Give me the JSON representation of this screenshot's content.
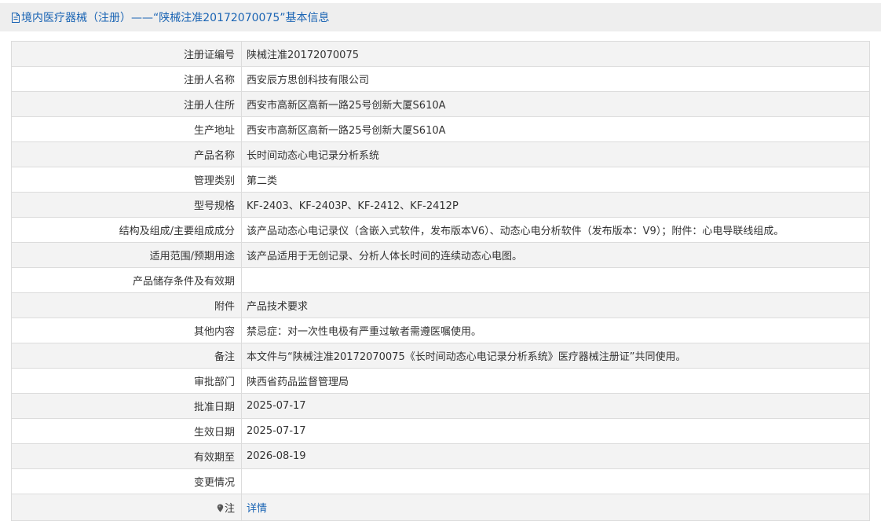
{
  "header": {
    "title": "境内医疗器械（注册）——“陕械注准20172070075”基本信息",
    "icon": "document-icon"
  },
  "rows": [
    {
      "label": "注册证编号",
      "value": "陕械注准20172070075"
    },
    {
      "label": "注册人名称",
      "value": "西安辰方思创科技有限公司"
    },
    {
      "label": "注册人住所",
      "value": "西安市高新区高新一路25号创新大厦S610A"
    },
    {
      "label": "生产地址",
      "value": "西安市高新区高新一路25号创新大厦S610A"
    },
    {
      "label": "产品名称",
      "value": "长时间动态心电记录分析系统"
    },
    {
      "label": "管理类别",
      "value": "第二类"
    },
    {
      "label": "型号规格",
      "value": "KF-2403、KF-2403P、KF-2412、KF-2412P"
    },
    {
      "label": "结构及组成/主要组成成分",
      "value": "该产品动态心电记录仪（含嵌入式软件，发布版本V6）、动态心电分析软件（发布版本：V9）；附件：心电导联线组成。"
    },
    {
      "label": "适用范围/预期用途",
      "value": "该产品适用于无创记录、分析人体长时间的连续动态心电图。"
    },
    {
      "label": "产品储存条件及有效期",
      "value": ""
    },
    {
      "label": "附件",
      "value": "产品技术要求"
    },
    {
      "label": "其他内容",
      "value": "禁忌症：对一次性电极有严重过敏者需遵医嘱使用。"
    },
    {
      "label": "备注",
      "value": "本文件与“陕械注准20172070075《长时间动态心电记录分析系统》医疗器械注册证”共同使用。"
    },
    {
      "label": "审批部门",
      "value": "陕西省药品监督管理局"
    },
    {
      "label": "批准日期",
      "value": "2025-07-17"
    },
    {
      "label": "生效日期",
      "value": "2025-07-17"
    },
    {
      "label": "有效期至",
      "value": "2026-08-19"
    },
    {
      "label": "变更情况",
      "value": ""
    }
  ],
  "note": {
    "label": "注",
    "icon": "map-pin-icon",
    "link_text": "详情"
  },
  "colors": {
    "accent": "#1a64b4",
    "row_alt": "#f3f3f3",
    "border": "#dcdcdc",
    "title_bg": "#eeeeee"
  }
}
